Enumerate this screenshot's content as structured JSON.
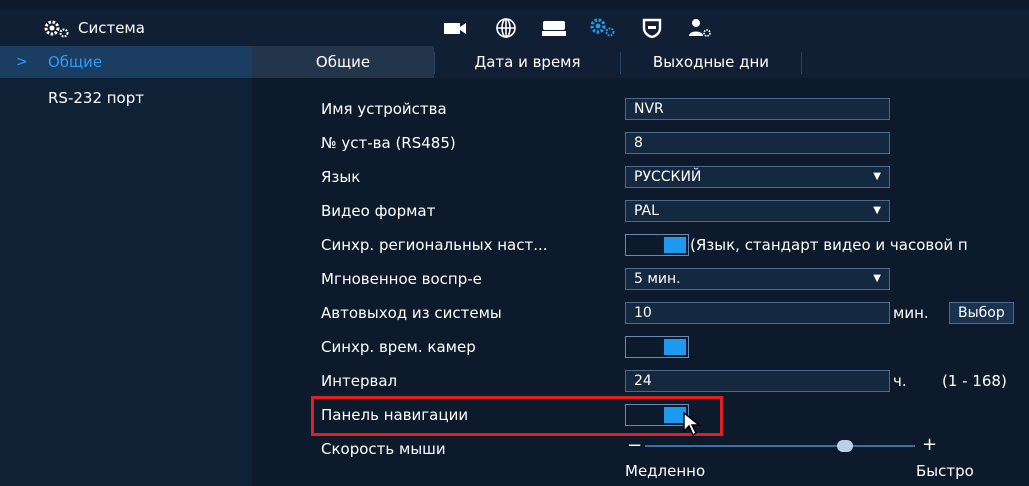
{
  "header": {
    "title": "Система",
    "icons": [
      "camera-icon",
      "network-icon",
      "storage-icon",
      "system-settings-icon",
      "security-icon",
      "account-icon"
    ]
  },
  "sidebar": {
    "items": [
      {
        "label": "Общие",
        "active": true
      },
      {
        "label": "RS-232 порт",
        "active": false
      }
    ]
  },
  "tabs": [
    {
      "label": "Общие",
      "active": true
    },
    {
      "label": "Дата и время",
      "active": false
    },
    {
      "label": "Выходные дни",
      "active": false
    }
  ],
  "form": {
    "device_name": {
      "label": "Имя устройства",
      "value": "NVR"
    },
    "device_no": {
      "label": "№ уст-ва (RS485)",
      "value": "8"
    },
    "language": {
      "label": "Язык",
      "value": "РУССКИЙ"
    },
    "video_format": {
      "label": "Видео формат",
      "value": "PAL"
    },
    "region_sync": {
      "label": "Синхр. региональных наст...",
      "enabled": true,
      "note": "(Язык, стандарт видео и часовой п"
    },
    "instant_playback": {
      "label": "Мгновенное воспр-е",
      "value": "5 мин."
    },
    "auto_logout": {
      "label": "Автовыход из системы",
      "value": "10",
      "unit": "мин.",
      "button": "Выбор"
    },
    "camera_time_sync": {
      "label": "Синхр. врем. камер",
      "enabled": true
    },
    "interval": {
      "label": "Интервал",
      "value": "24",
      "unit": "ч.",
      "range": "(1 - 168)"
    },
    "nav_bar": {
      "label": "Панель навигации",
      "enabled": true
    },
    "mouse_speed": {
      "label": "Скорость мыши",
      "minus": "−",
      "plus": "+",
      "slow": "Медленно",
      "fast": "Быстро",
      "level": 0.74
    }
  },
  "colors": {
    "accent": "#1e9bf0",
    "highlight": "#e02020",
    "background": "#0c1a2b"
  }
}
